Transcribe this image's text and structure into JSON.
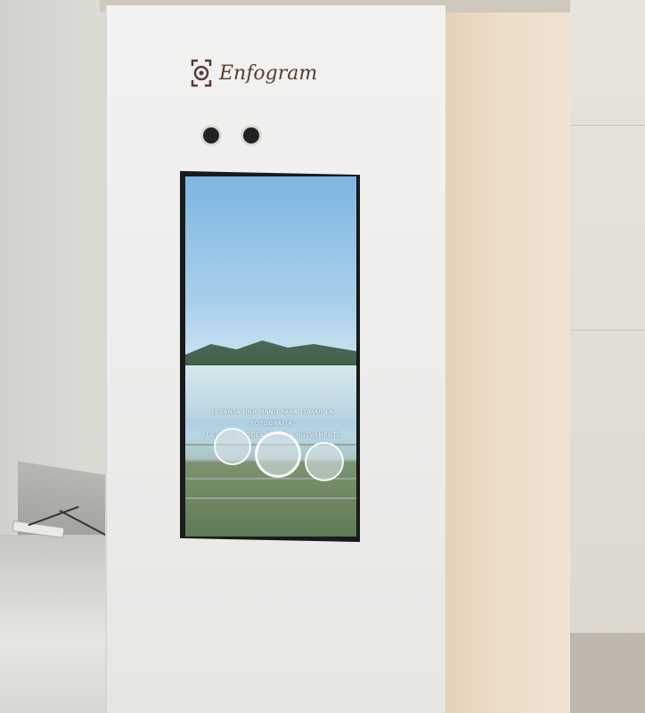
{
  "kiosk": {
    "brand": "Enfogram",
    "instruction_line1": "LEVANTÁ UNA MANO PARA TOMAR LA FOTOGRAFÍA.",
    "instruction_line2": "SI QUERÉS, PODÉS BAJARLA NUEVAMENTE."
  },
  "colors": {
    "kiosk_front": "#efefed",
    "kiosk_side": "#ecdcc7",
    "logo": "#5a3a2e",
    "accent_glow": "#5a53e6"
  },
  "icons": [
    "enfogram-logo-icon",
    "camera-sensor-icon",
    "camera-sensor-icon"
  ]
}
